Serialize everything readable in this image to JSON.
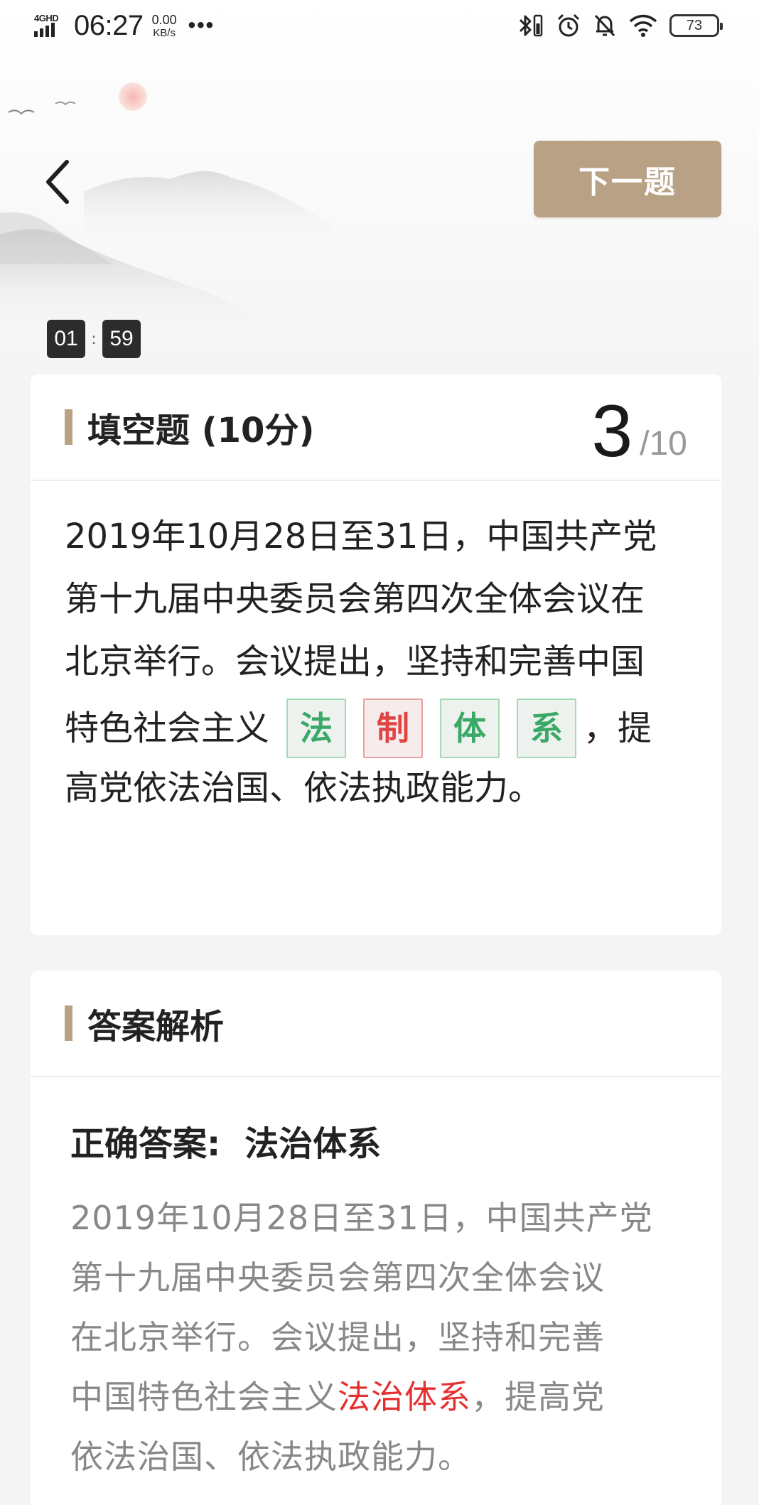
{
  "status_bar": {
    "network": "4GHD",
    "time": "06:27",
    "speed_value": "0.00",
    "speed_unit": "KB/s",
    "more": "•••",
    "battery": "73",
    "icons": [
      "bluetooth-icon",
      "alarm-icon",
      "mute-bell-icon",
      "wifi-icon",
      "battery-icon"
    ]
  },
  "nav": {
    "back_icon": "chevron-left-icon",
    "next_label": "下一题"
  },
  "timer": {
    "minutes": "01",
    "separator": ":",
    "seconds": "59"
  },
  "question": {
    "title": "填空题 (10分)",
    "current": "3",
    "total": "/10",
    "lines": [
      "2019年10月28日至31日，中国共产党",
      "第十九届中央委员会第四次全体会议在",
      "北京举行。会议提出，坚持和完善中国"
    ],
    "blank_line_prefix": "特色社会主义",
    "blanks": [
      {
        "char": "法",
        "status": "correct"
      },
      {
        "char": "制",
        "status": "wrong"
      },
      {
        "char": "体",
        "status": "correct"
      },
      {
        "char": "系",
        "status": "correct"
      }
    ],
    "blank_line_suffix": "，提",
    "last_line": "高党依法治国、依法执政能力。"
  },
  "analysis": {
    "title": "答案解析",
    "answer_label": "正确答案:",
    "answer_value": "法治体系",
    "lines": [
      "2019年10月28日至31日，中国共产党",
      "第十九届中央委员会第四次全体会议",
      "在北京举行。会议提出，坚持和完善"
    ],
    "highlight_prefix": "中国特色社会主义",
    "highlight": "法治体系",
    "highlight_suffix": "，提高党",
    "last_line": "依法治国、依法执政能力。"
  },
  "colors": {
    "accent": "#b9a185",
    "correct": "#3aa866",
    "wrong": "#e04545",
    "highlight": "#e53030"
  }
}
